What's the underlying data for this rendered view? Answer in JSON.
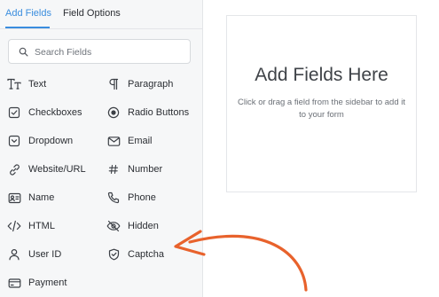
{
  "tabs": {
    "add_fields": "Add Fields",
    "field_options": "Field Options"
  },
  "search": {
    "placeholder": "Search Fields"
  },
  "fields": [
    {
      "label": "Text",
      "icon": "text-type-icon"
    },
    {
      "label": "Paragraph",
      "icon": "paragraph-icon"
    },
    {
      "label": "Checkboxes",
      "icon": "checkbox-icon"
    },
    {
      "label": "Radio Buttons",
      "icon": "radio-icon"
    },
    {
      "label": "Dropdown",
      "icon": "dropdown-icon"
    },
    {
      "label": "Email",
      "icon": "email-icon"
    },
    {
      "label": "Website/URL",
      "icon": "link-icon"
    },
    {
      "label": "Number",
      "icon": "hash-icon"
    },
    {
      "label": "Name",
      "icon": "id-card-icon"
    },
    {
      "label": "Phone",
      "icon": "phone-icon"
    },
    {
      "label": "HTML",
      "icon": "code-icon"
    },
    {
      "label": "Hidden",
      "icon": "eye-off-icon"
    },
    {
      "label": "User ID",
      "icon": "user-icon"
    },
    {
      "label": "Captcha",
      "icon": "shield-check-icon"
    },
    {
      "label": "Payment",
      "icon": "credit-card-icon"
    }
  ],
  "dropzone": {
    "title": "Add Fields Here",
    "subtitle": "Click or drag a field from the sidebar to add it to your form"
  },
  "colors": {
    "accent": "#3a8dde",
    "annotation_arrow": "#e8622c",
    "sidebar_bg": "#f6f7f8"
  }
}
